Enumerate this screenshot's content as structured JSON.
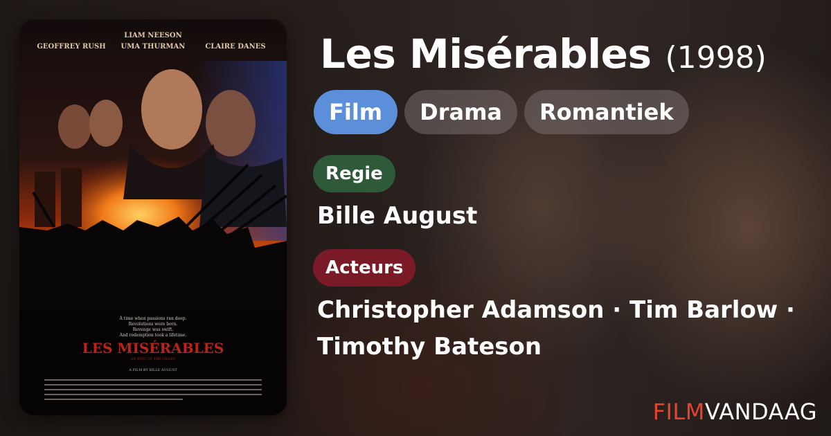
{
  "movie": {
    "title": "Les Misérables",
    "year": "(1998)"
  },
  "tags": [
    {
      "label": "Film",
      "color": "#5b8fd9"
    },
    {
      "label": "Drama"
    },
    {
      "label": "Romantiek"
    }
  ],
  "director": {
    "label": "Regie",
    "label_color": "#2e5a3a",
    "name": "Bille August"
  },
  "cast": {
    "label": "Acteurs",
    "label_color": "#7a1a26",
    "names": "Christopher Adamson · Tim Barlow · Timothy Bateson"
  },
  "poster": {
    "actors_top": "LIAM NEESON",
    "actors_left": "GEOFFREY RUSH",
    "actors_mid": "UMA THURMAN",
    "actors_right": "CLAIRE DANES",
    "tagline_1": "A time when passions ran deep.",
    "tagline_2": "Revolutions were born.",
    "tagline_3": "Revenge was swift.",
    "tagline_4": "And redemption took a lifetime.",
    "film_title": "LES MISÉRABLES",
    "subtitle": "AN EPIC OF THE HEART",
    "credit": "A FILM BY BILLE AUGUST"
  },
  "brand": {
    "part1": "FILM",
    "part2": "VANDAAG",
    "accent": "#e8432e"
  }
}
